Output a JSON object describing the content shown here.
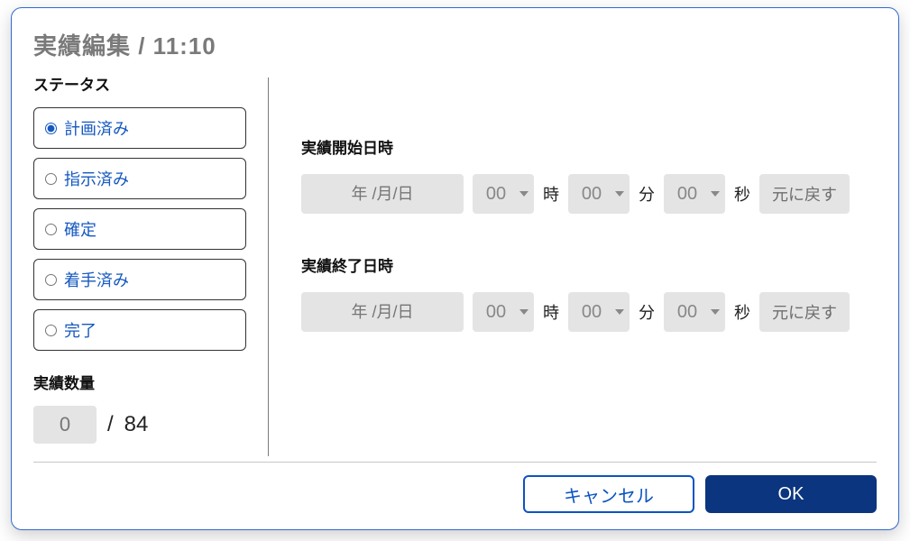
{
  "dialog": {
    "title": "実績編集 / 11:10"
  },
  "status": {
    "label": "ステータス",
    "options": [
      "計画済み",
      "指示済み",
      "確定",
      "着手済み",
      "完了"
    ],
    "selected_index": 0
  },
  "quantity": {
    "label": "実績数量",
    "value": "0",
    "total": "84",
    "separator": "/"
  },
  "start": {
    "label": "実績開始日時",
    "date_placeholder": "年 /月/日",
    "hour": "00",
    "minute": "00",
    "second": "00",
    "hour_unit": "時",
    "minute_unit": "分",
    "second_unit": "秒",
    "reset_label": "元に戻す"
  },
  "end": {
    "label": "実績終了日時",
    "date_placeholder": "年 /月/日",
    "hour": "00",
    "minute": "00",
    "second": "00",
    "hour_unit": "時",
    "minute_unit": "分",
    "second_unit": "秒",
    "reset_label": "元に戻す"
  },
  "buttons": {
    "cancel": "キャンセル",
    "ok": "OK"
  }
}
